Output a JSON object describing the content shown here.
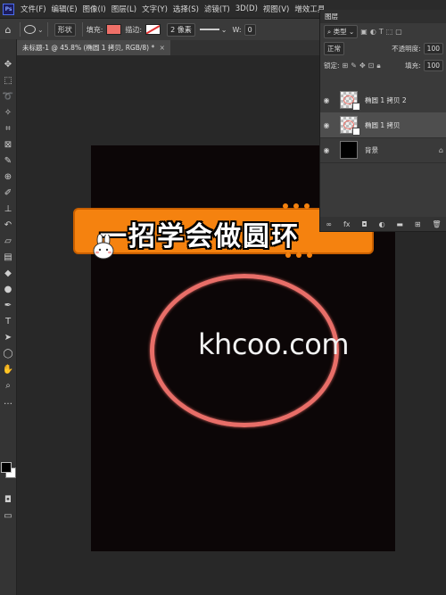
{
  "app": {
    "logo_text": "Ps",
    "menu": [
      "文件(F)",
      "编辑(E)",
      "图像(I)",
      "图层(L)",
      "文字(Y)",
      "选择(S)",
      "滤镜(T)",
      "3D(D)",
      "视图(V)",
      "增效工具"
    ]
  },
  "options_bar": {
    "shape_mode": "形状",
    "fill_label": "填充:",
    "stroke_label": "描边:",
    "stroke_width": "2 像素",
    "width_label": "W:",
    "width_value": "0",
    "fill_color": "#ef7068"
  },
  "document": {
    "tab_label": "未标题-1 @ 45.8% (椭圆 1 拷贝, RGB/8) *",
    "close_glyph": "×"
  },
  "canvas": {
    "watermark": "khcoo.com",
    "banner_title": "一招学会做圆环",
    "ring_color": "#e86e68",
    "banner_color": "#f5820f"
  },
  "layers_panel": {
    "title": "图层",
    "filter_kind": "类型",
    "blend_mode": "正常",
    "opacity_label": "不透明度:",
    "opacity_value": "100",
    "lock_label": "锁定:",
    "fill_label": "填充:",
    "fill_value": "100",
    "layers": [
      {
        "name": "椭圆 1 拷贝 2",
        "selected": false
      },
      {
        "name": "椭圆 1 拷贝",
        "selected": true
      },
      {
        "name": "背景",
        "selected": false
      }
    ]
  }
}
